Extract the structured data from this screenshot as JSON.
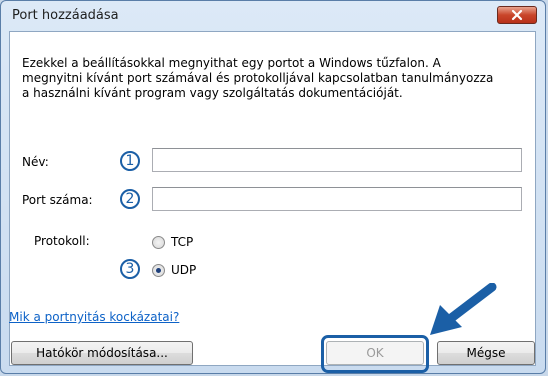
{
  "window": {
    "title": "Port hozzáadása",
    "close_icon": "close-x-icon"
  },
  "description": "Ezekkel a beállításokkal megnyithat egy portot a Windows tűzfalon. A megnyitni kívánt port számával és protokolljával kapcsolatban tanulmányozza a használni kívánt program vagy szolgáltatás dokumentációját.",
  "fields": {
    "name_label": "Név:",
    "name_value": "",
    "port_label": "Port száma:",
    "port_value": ""
  },
  "protocol": {
    "label": "Protokoll:",
    "options": [
      {
        "label": "TCP",
        "selected": false
      },
      {
        "label": "UDP",
        "selected": true
      }
    ]
  },
  "callouts": [
    "1",
    "2",
    "3"
  ],
  "link": "Mik a portnyitás kockázatai?",
  "buttons": {
    "scope": "Hatókör módosítása...",
    "ok": "OK",
    "cancel": "Mégse"
  },
  "colors": {
    "callout": "#1b5fa6",
    "link": "#0d62c7",
    "close_button": "#c9452a"
  }
}
